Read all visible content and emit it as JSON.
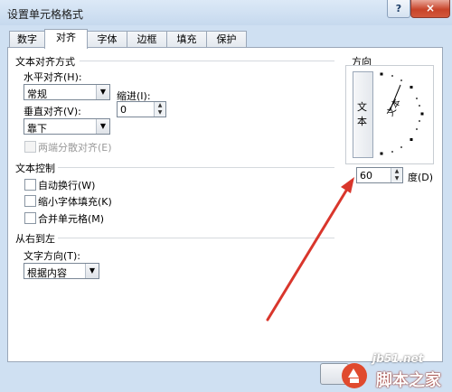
{
  "window": {
    "title": "设置单元格格式",
    "help_label": "?",
    "close_label": "×"
  },
  "tabs": [
    {
      "label": "数字",
      "active": false
    },
    {
      "label": "对齐",
      "active": true
    },
    {
      "label": "字体",
      "active": false
    },
    {
      "label": "边框",
      "active": false
    },
    {
      "label": "填充",
      "active": false
    },
    {
      "label": "保护",
      "active": false
    }
  ],
  "text_alignment": {
    "group_title": "文本对齐方式",
    "horizontal_label": "水平对齐(H):",
    "horizontal_value": "常规",
    "indent_label": "缩进(I):",
    "indent_value": "0",
    "vertical_label": "垂直对齐(V):",
    "vertical_value": "靠下",
    "justify_distributed_label": "两端分散对齐(E)"
  },
  "text_control": {
    "group_title": "文本控制",
    "wrap_text": "自动换行(W)",
    "shrink_to_fit": "缩小字体填充(K)",
    "merge_cells": "合并单元格(M)"
  },
  "rtl": {
    "group_title": "从右到左",
    "direction_label": "文字方向(T):",
    "direction_value": "根据内容"
  },
  "orientation": {
    "group_title": "方向",
    "vertical_text_1": "文",
    "vertical_text_2": "本",
    "dial_text": "文本",
    "degrees_value": "60",
    "degrees_label": "度(D)"
  },
  "watermark": {
    "url": "jb51.net",
    "name": "脚本之家"
  },
  "colors": {
    "annotation_arrow": "#d9362c",
    "titlebar": "#c6d9ee",
    "close_button": "#c8442a"
  }
}
